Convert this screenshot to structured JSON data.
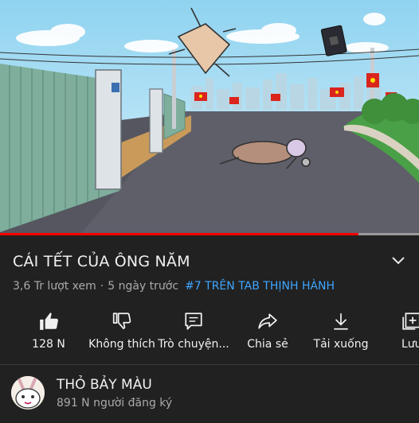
{
  "video": {
    "progress": 0.855,
    "flag_colors": {
      "red": "#da251d",
      "star": "#ffdf00"
    }
  },
  "title": "CÁI TẾT CỦA ÔNG NĂM",
  "meta": {
    "views": "3,6 Tr lượt xem",
    "separator": "·",
    "age": "5 ngày trước",
    "trending": "#7 TRÊN TAB THỊNH HÀNH"
  },
  "actions": {
    "like": {
      "label": "128 N",
      "icon": "thumbs-up-filled"
    },
    "dislike": {
      "label": "Không thích",
      "icon": "thumbs-down"
    },
    "chat": {
      "label": "Trò chuyện...",
      "icon": "chat-bubble"
    },
    "share": {
      "label": "Chia sẻ",
      "icon": "share-arrow"
    },
    "download": {
      "label": "Tải xuống",
      "icon": "download-arrow"
    },
    "save": {
      "label": "Lưu",
      "icon": "add-to-playlist"
    }
  },
  "channel": {
    "name": "THỎ BẢY MÀU",
    "subscribers": "891 N người đăng ký"
  },
  "colors": {
    "background": "#212121",
    "link": "#3ea6ff",
    "secondary_text": "#aaaaaa",
    "progress": "#ff0000"
  }
}
